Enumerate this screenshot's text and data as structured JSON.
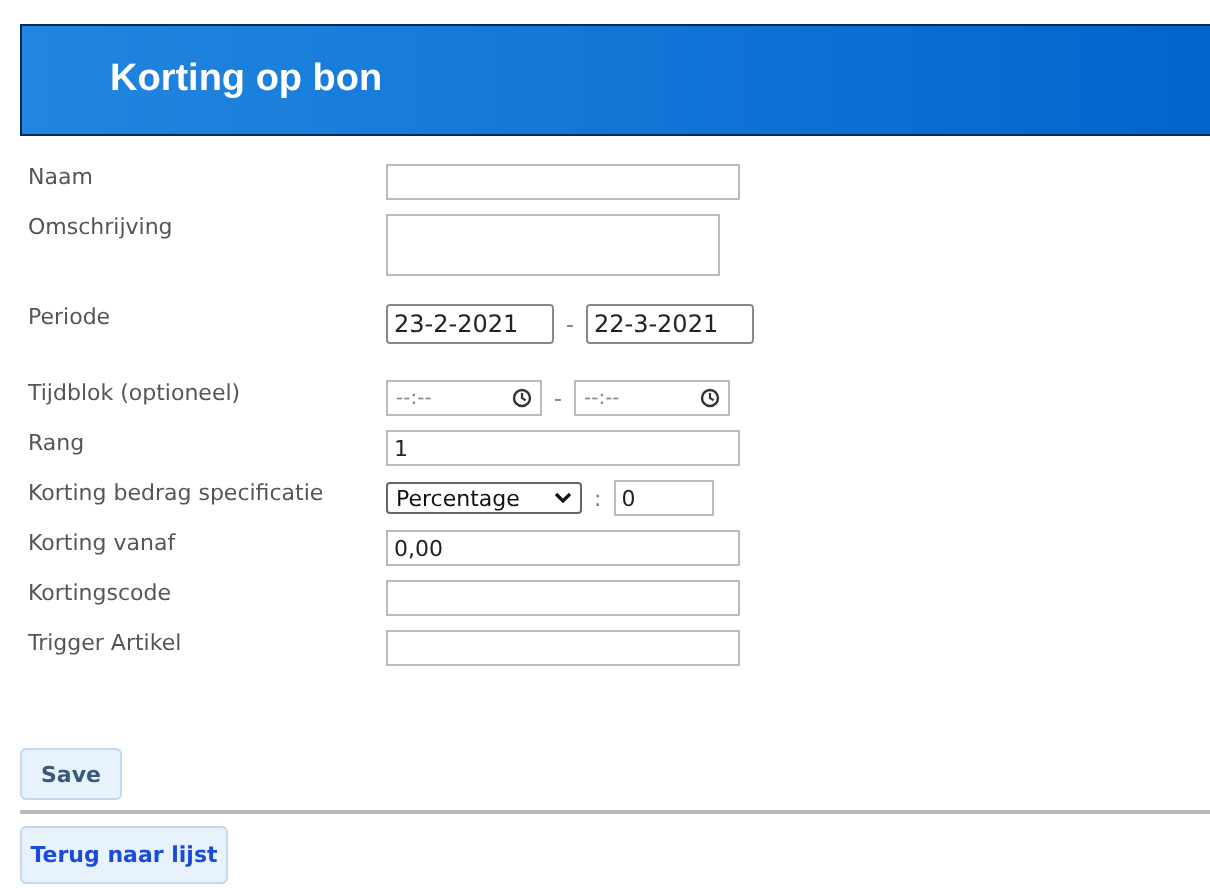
{
  "header": {
    "title": "Korting op bon"
  },
  "fields": [
    {
      "kind": "text",
      "label": "Naam"
    },
    {
      "kind": "textarea",
      "label": "Omschrijving"
    },
    {
      "kind": "date-range",
      "label": "Periode",
      "from": "23-2-2021",
      "separator": "-",
      "to": "22-3-2021"
    },
    {
      "kind": "time-range",
      "label": "Tijdblok (optioneel)",
      "from_placeholder": "--:--",
      "separator": "-",
      "to_placeholder": "--:--"
    },
    {
      "kind": "text",
      "label": "Rang",
      "value": "1"
    },
    {
      "kind": "select-number",
      "label": "Korting bedrag specificatie",
      "option": "Percentage",
      "separator": ":",
      "value": "0"
    },
    {
      "kind": "text",
      "label": "Korting vanaf",
      "value": "0,00"
    },
    {
      "kind": "text",
      "label": "Kortingscode"
    },
    {
      "kind": "text",
      "label": "Trigger Artikel"
    }
  ],
  "save_button": "Save",
  "back_button": "Terug naar lijst"
}
